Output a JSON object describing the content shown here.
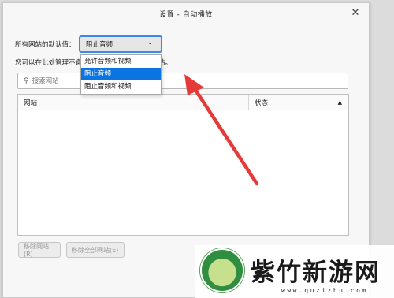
{
  "dialog": {
    "title": "设置 - 自动播放",
    "close_glyph": "✕"
  },
  "defaults": {
    "label": "所有网站的默认值：",
    "selected": "阻止音频",
    "chevron_glyph": "⌄"
  },
  "dropdown": {
    "options": [
      "允许音频和视频",
      "阻止音频",
      "阻止音频和视频"
    ],
    "selected_index": 1
  },
  "description": {
    "visible_start": "您可以在此处管理不遵",
    "visible_end": "站。"
  },
  "search": {
    "placeholder": "搜索网站",
    "icon_glyph": "⚲"
  },
  "table": {
    "columns": [
      "网站",
      "状态"
    ],
    "sort_glyph": "▲"
  },
  "buttons": {
    "remove_site": "移除网站(R)",
    "remove_all": "移除全部网站(E)"
  },
  "colors": {
    "accent": "#0a74e0",
    "arrow": "#e63a3a"
  },
  "watermark": {
    "name": "紫竹新游网",
    "url": "www.quzizhu.com"
  }
}
